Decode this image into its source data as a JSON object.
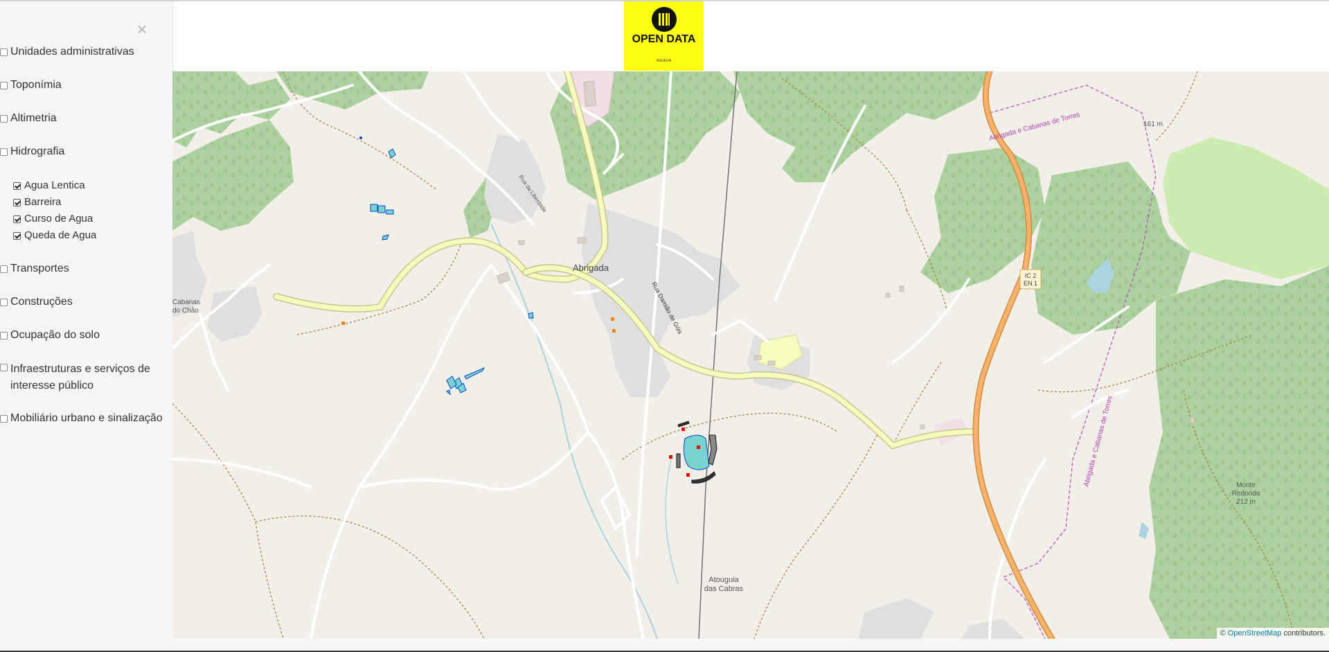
{
  "sidebar": {
    "close_label": "×",
    "layers": [
      {
        "label": "Unidades administrativas",
        "checked": false
      },
      {
        "label": "Toponímia",
        "checked": false
      },
      {
        "label": "Altimetria",
        "checked": false
      },
      {
        "label": "Hidrografia",
        "checked": false
      },
      {
        "label": "Transportes",
        "checked": false
      },
      {
        "label": "Construções",
        "checked": false
      },
      {
        "label": "Ocupação do solo",
        "checked": false
      },
      {
        "label": "Infraestruturas e serviços de interesse público",
        "checked": false
      },
      {
        "label": "Mobiliário urbano e sinalização",
        "checked": false
      }
    ],
    "hidrografia_sublayers": [
      {
        "label": "Agua Lentica",
        "checked": true
      },
      {
        "label": "Barreira",
        "checked": true
      },
      {
        "label": "Curso de Agua",
        "checked": true
      },
      {
        "label": "Queda de Agua",
        "checked": true
      }
    ]
  },
  "header": {
    "logo_text": "OPEN DATA",
    "logo_sub": "ÁGUEDA"
  },
  "map": {
    "place_labels": {
      "abrigada": "Abrigada",
      "cabanas": "Cabanas",
      "do_chao": "do Chão",
      "atouguia_1": "Atouguia",
      "atouguia_2": "das Cabras",
      "monte_1": "Monte",
      "monte_2": "Redondo",
      "monte_3": "212 m",
      "peak_161": "161 m",
      "road_ic2": "IC 2",
      "road_en1": "EN 1",
      "street_liberdade": "Rua da Liberdade",
      "street_damiao": "Rua Damião de Góis",
      "boundary_1": "Abrigada e Cabanas de Torres",
      "boundary_2": "Abrigada e Cabanas de Torres"
    },
    "colors": {
      "background": "#f2efe9",
      "forest": "#add19e",
      "meadow": "#cdebb0",
      "residential": "#e0dfdf",
      "primary_road": "#f7fabf",
      "trunk_road": "#f9b26c",
      "water": "#aad3df",
      "overlay_water": "#3399ff",
      "overlay_water_fill": "#7ad3d0",
      "marker_red": "#ee0000",
      "marker_orange": "#f08a00"
    },
    "attribution_prefix": "© ",
    "attribution_link": "OpenStreetMap",
    "attribution_suffix": " contributors."
  }
}
